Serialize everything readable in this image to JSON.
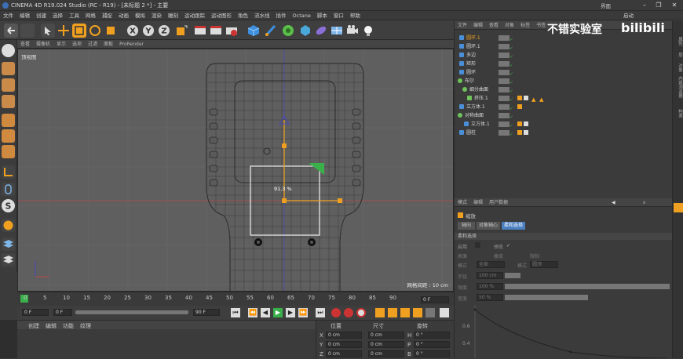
{
  "window": {
    "title": "CINEMA 4D R19.024 Studio (RC - R19) - [未标题 2 *] - 主要",
    "layout_label": "界面",
    "layout_value": "启动"
  },
  "menubar": [
    "文件",
    "编辑",
    "创建",
    "选择",
    "工具",
    "网格",
    "捕捉",
    "动画",
    "模拟",
    "渲染",
    "雕刻",
    "运动跟踪",
    "运动图形",
    "角色",
    "流水线",
    "插件",
    "Octane",
    "脚本",
    "窗口",
    "帮助"
  ],
  "viewport": {
    "menu": [
      "查看",
      "摄像机",
      "显示",
      "选项",
      "过滤",
      "面板",
      "ProRender"
    ],
    "label": "顶视图",
    "scale_text": "网格间距 : 10 cm",
    "scale_value": "91.3 %"
  },
  "timeline": {
    "ticks": [
      "0",
      "5",
      "10",
      "15",
      "20",
      "25",
      "30",
      "35",
      "40",
      "45",
      "50",
      "55",
      "60",
      "65",
      "70",
      "75",
      "80",
      "85",
      "90"
    ],
    "end_field": "0 F"
  },
  "playbar": {
    "current": "0 F",
    "start": "0 F",
    "end": "90 F",
    "range_end": "90 F"
  },
  "materials_menu": [
    "创建",
    "编辑",
    "功能",
    "纹理"
  ],
  "coords": {
    "headers": [
      "位置",
      "尺寸",
      "旋转"
    ],
    "rows": [
      {
        "axis": "X",
        "pos": "0 cm",
        "size": "0 cm",
        "rot_axis": "H",
        "rot": "0 °"
      },
      {
        "axis": "Y",
        "pos": "0 cm",
        "size": "0 cm",
        "rot_axis": "P",
        "rot": "0 °"
      },
      {
        "axis": "Z",
        "pos": "0 cm",
        "size": "0 cm",
        "rot_axis": "B",
        "rot": "0 °"
      }
    ]
  },
  "object_manager": {
    "menu": [
      "文件",
      "编辑",
      "查看",
      "对象",
      "标签",
      "书签"
    ],
    "items": [
      {
        "name": "圆环.1",
        "indent": 0,
        "color": "#4a8fd8",
        "selected": true
      },
      {
        "name": "圆环.1",
        "indent": 0,
        "color": "#4a8fd8"
      },
      {
        "name": "多边",
        "indent": 0,
        "color": "#4a8fd8"
      },
      {
        "name": "矩形",
        "indent": 0,
        "color": "#4a8fd8"
      },
      {
        "name": "圆环",
        "indent": 0,
        "color": "#4a8fd8"
      },
      {
        "name": "布尔",
        "indent": 0,
        "color": "#6fc35b"
      },
      {
        "name": "细分曲面",
        "indent": 1,
        "color": "#6fc35b"
      },
      {
        "name": "挤压.1",
        "indent": 2,
        "color": "#6fc35b"
      },
      {
        "name": "立方体.1",
        "indent": 0,
        "color": "#4a8fd8"
      },
      {
        "name": "对称曲面",
        "indent": 0,
        "color": "#6fc35b"
      },
      {
        "name": "立方体.1",
        "indent": 1,
        "color": "#4a8fd8"
      },
      {
        "name": "圆柱",
        "indent": 0,
        "color": "#4a8fd8"
      }
    ]
  },
  "attributes": {
    "menu": [
      "模式",
      "编辑",
      "用户数据"
    ],
    "tool_name": "缩放",
    "tabs": [
      "轴向",
      "对象轴心",
      "柔和选择"
    ],
    "section": "柔和选择",
    "rows": [
      {
        "label": "启用",
        "value": "",
        "label2": "预览",
        "value2": "✓"
      },
      {
        "label": "表面",
        "value": "",
        "label2": "橡皮",
        "value2": "",
        "label3": "限制",
        "value3": ""
      },
      {
        "label": "模式",
        "value": "全部",
        "label2": "模式",
        "value2": "圆顶"
      },
      {
        "label": "半径",
        "value": "100 cm"
      },
      {
        "label": "强度",
        "value": "100 %"
      },
      {
        "label": "宽度",
        "value": "50 %"
      }
    ],
    "graph_labels": [
      "0.6",
      "0.4"
    ]
  },
  "side_tabs": [
    "属性",
    "层",
    "对象",
    "内容浏览器",
    "构造"
  ],
  "watermark": {
    "text": "不错实验室",
    "brand": "bilibili"
  }
}
